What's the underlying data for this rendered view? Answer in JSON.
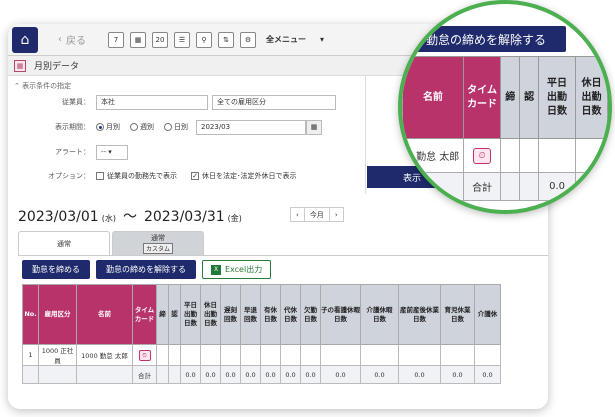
{
  "toolbar": {
    "back_label": "戻る",
    "menu_label": "全メニュー",
    "icons": [
      "calendar-7-icon",
      "calendar-icon",
      "calendar-2020-icon",
      "list-icon",
      "search-icon",
      "sort-icon",
      "settings-icon"
    ]
  },
  "subbar": {
    "title": "月別データ"
  },
  "conditions": {
    "header": "表示条件の指定",
    "employee_label": "従業員：",
    "employee_value": "本社",
    "employment_value": "全ての雇用区分",
    "period_label": "表示期間：",
    "period_options": [
      "月別",
      "週別",
      "日別"
    ],
    "period_value": "2023/03",
    "alert_label": "アラート：",
    "alert_value": "--",
    "option_label": "オプション：",
    "option1": "従業員の勤務先で表示",
    "option2": "休日を法定･法定外休日で表示",
    "show_button": "表示"
  },
  "range": {
    "start": "2023/03/01",
    "start_dow": "(水)",
    "sep": "〜",
    "end": "2023/03/31",
    "end_dow": "(金)",
    "prev": "‹",
    "today": "今月",
    "next": "›"
  },
  "tabs": {
    "active": "通常",
    "inactive": "通常",
    "inactive_badge": "カスタム"
  },
  "actions": {
    "close": "勤怠を締める",
    "unclose": "勤怠の締めを解除する",
    "excel": "Excel出力"
  },
  "table": {
    "headers": [
      "No.",
      "雇用区分",
      "名前",
      "タイム\nカード",
      "締",
      "認",
      "平日\n出勤\n日数",
      "休日\n出勤\n日数",
      "遅刻\n回数",
      "早退\n回数",
      "有休\n日数",
      "代休\n日数",
      "欠勤\n日数",
      "子の看護休暇\n日数",
      "介護休暇\n日数",
      "産前産後休業\n日数",
      "育児休業\n日数",
      "介護休"
    ],
    "row": {
      "no": "1",
      "type": "1000 正社員",
      "name": "1000 勤怠 太郎"
    },
    "total_label": "合計",
    "zero": "0.0"
  },
  "zoom": {
    "bar": "勤怠の締めを解除する",
    "headers": [
      "名前",
      "タイム\nカード",
      "締",
      "認",
      "平日\n出勤\n日数",
      "休日\n出勤\n日数"
    ],
    "name": "0 勤怠 太郎",
    "total_label": "合計",
    "zero": "0.0"
  }
}
